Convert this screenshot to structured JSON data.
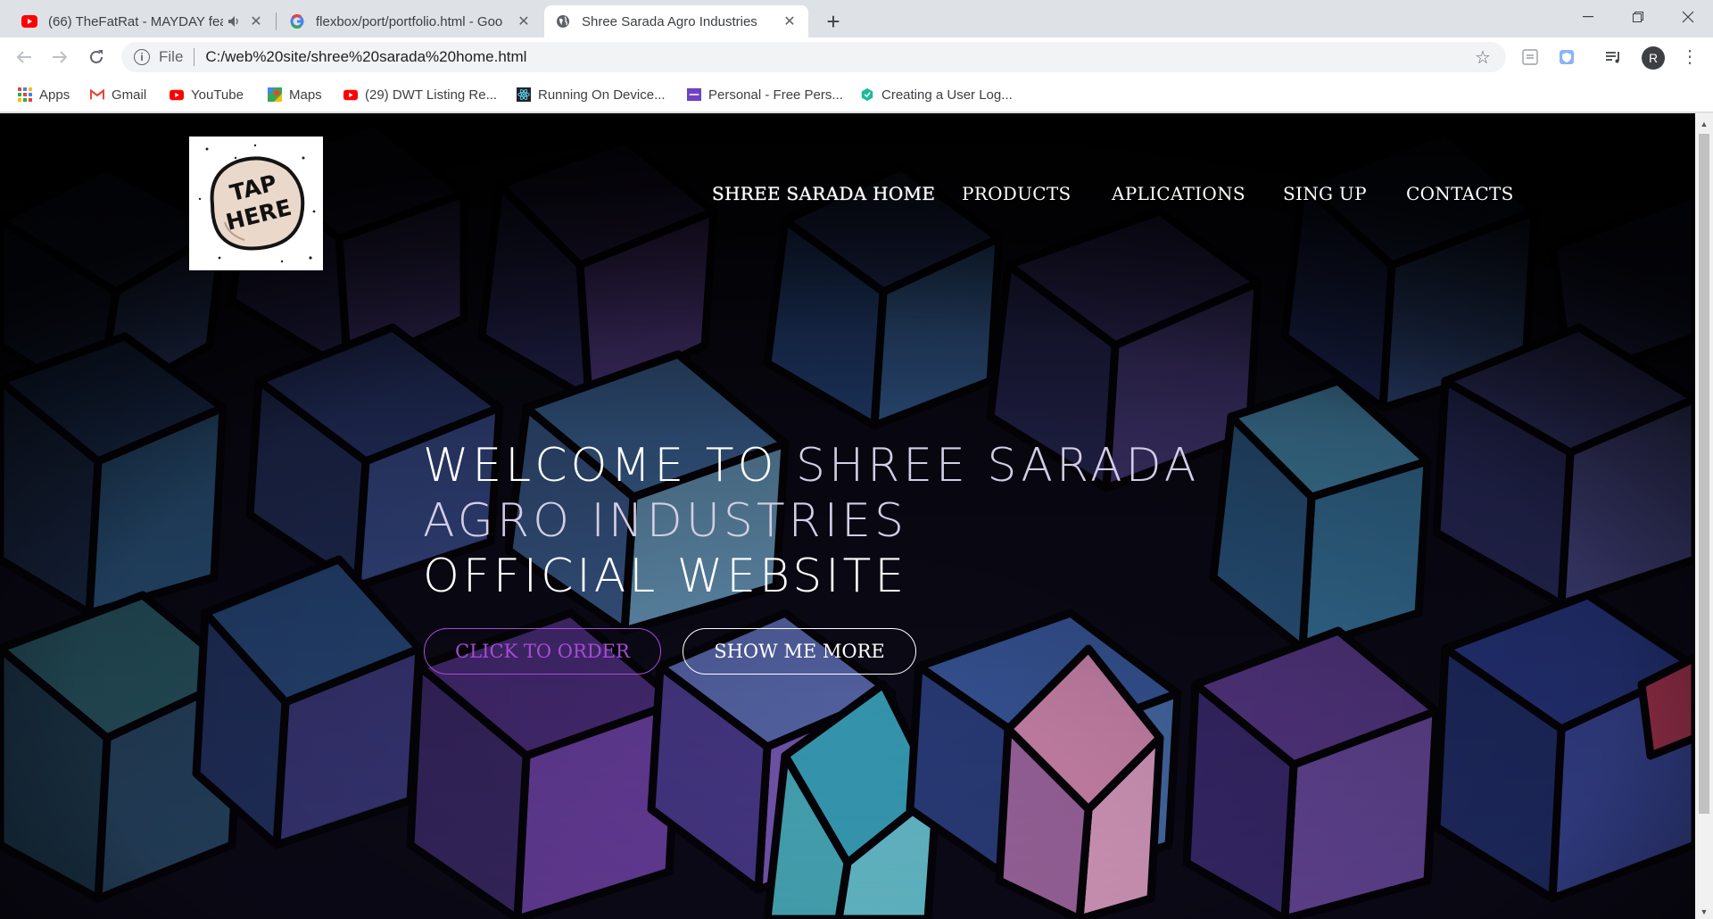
{
  "browser": {
    "tabs": [
      {
        "title": "(66) TheFatRat - MAYDAY fea",
        "favicon": "youtube-icon",
        "muted_icon": "speaker-icon",
        "active": false
      },
      {
        "title": "flexbox/port/portfolio.html - Goo",
        "favicon": "google-icon",
        "active": false
      },
      {
        "title": "Shree Sarada Agro Industries",
        "favicon": "globe-icon",
        "active": true
      }
    ],
    "new_tab": "+",
    "address": {
      "scheme": "File",
      "url": "C:/web%20site/shree%20sarada%20home.html"
    },
    "profile_initial": "R",
    "bookmarks": [
      {
        "label": "Apps",
        "icon": "apps-grid-icon"
      },
      {
        "label": "Gmail",
        "icon": "gmail-icon"
      },
      {
        "label": "YouTube",
        "icon": "youtube-icon"
      },
      {
        "label": "Maps",
        "icon": "maps-icon"
      },
      {
        "label": "(29) DWT Listing Re...",
        "icon": "youtube-icon"
      },
      {
        "label": "Running On Device...",
        "icon": "react-icon"
      },
      {
        "label": "Personal - Free Pers...",
        "icon": "colorlib-icon"
      },
      {
        "label": "Creating a User Log...",
        "icon": "hexagon-icon"
      }
    ]
  },
  "site": {
    "logo_text": [
      "TAP",
      "HERE"
    ],
    "nav": [
      {
        "label": "SHREE SARADA HOME"
      },
      {
        "label": "PRODUCTS"
      },
      {
        "label": "APLICATIONS"
      },
      {
        "label": "SING UP"
      },
      {
        "label": "CONTACTS"
      }
    ],
    "hero": {
      "line1_a": "WELCOME TO ",
      "line1_b": "SHREE SARADA",
      "line2": "AGRO INDUSTRIES",
      "line3": "OFFICIAL WEBSITE"
    },
    "buttons": {
      "order": "CLICK TO ORDER",
      "more": "SHOW ME MORE"
    },
    "colors": {
      "accent": "#a64bd6",
      "background": "#07060d"
    }
  }
}
